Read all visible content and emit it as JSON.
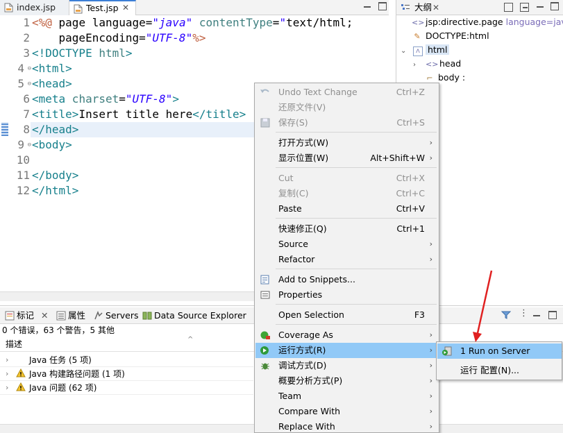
{
  "editor": {
    "tabs": [
      {
        "label": "index.jsp"
      },
      {
        "label": "Test.jsp",
        "active": true
      }
    ],
    "lines": [
      {
        "num": "1",
        "text": "<%@ page language=\"java\" contentType=\"text/html;"
      },
      {
        "num": "2",
        "text": "    pageEncoding=\"UTF-8\"%>"
      },
      {
        "num": "3",
        "text": "<!DOCTYPE html>"
      },
      {
        "num": "4",
        "text": "<html>"
      },
      {
        "num": "5",
        "text": "<head>"
      },
      {
        "num": "6",
        "text": "<meta charset=\"UTF-8\">"
      },
      {
        "num": "7",
        "text": "<title>Insert title here</title>"
      },
      {
        "num": "8",
        "text": "</head>"
      },
      {
        "num": "9",
        "text": "<body>"
      },
      {
        "num": "10",
        "text": ""
      },
      {
        "num": "11",
        "text": "</body>"
      },
      {
        "num": "12",
        "text": "</html>"
      }
    ],
    "fold_marker": "⊖"
  },
  "outline": {
    "tab_label": "大纲",
    "items": [
      {
        "label": "jsp:directive.page",
        "attr": "language=java"
      },
      {
        "label": "DOCTYPE:html"
      },
      {
        "label": "html"
      },
      {
        "label": "head"
      },
      {
        "label": "body :"
      }
    ]
  },
  "bottom": {
    "tabs": [
      {
        "label": "标记",
        "close": "✕"
      },
      {
        "label": "属性"
      },
      {
        "label": "Servers"
      },
      {
        "label": "Data Source Explorer"
      }
    ],
    "summary": "0 个错误，63 个警告，5 其他",
    "header": "描述",
    "rows": [
      {
        "label": "Java 任务  (5 项)"
      },
      {
        "label": "Java 构建路径问题  (1 项)"
      },
      {
        "label": "Java 问题  (62 项)"
      }
    ]
  },
  "context_menu": {
    "items": [
      {
        "label": "Undo Text Change",
        "shortcut": "Ctrl+Z",
        "disabled": true
      },
      {
        "label": "还原文件(V)",
        "disabled": true
      },
      {
        "label": "保存(S)",
        "shortcut": "Ctrl+S",
        "disabled": true
      },
      {
        "label": "打开方式(W)",
        "arrow": "›"
      },
      {
        "label": "显示位置(W)",
        "shortcut": "Alt+Shift+W",
        "arrow": "›"
      },
      {
        "label": "Cut",
        "shortcut": "Ctrl+X",
        "disabled": true
      },
      {
        "label": "复制(C)",
        "shortcut": "Ctrl+C",
        "disabled": true
      },
      {
        "label": "Paste",
        "shortcut": "Ctrl+V"
      },
      {
        "label": "快速修正(Q)",
        "shortcut": "Ctrl+1"
      },
      {
        "label": "Source",
        "arrow": "›"
      },
      {
        "label": "Refactor",
        "arrow": "›"
      },
      {
        "label": "Add to Snippets..."
      },
      {
        "label": "Properties"
      },
      {
        "label": "Open Selection",
        "shortcut": "F3"
      },
      {
        "label": "Coverage As",
        "arrow": "›"
      },
      {
        "label": "运行方式(R)",
        "arrow": "›",
        "selected": true
      },
      {
        "label": "调试方式(D)",
        "arrow": "›"
      },
      {
        "label": "概要分析方式(P)",
        "arrow": "›"
      },
      {
        "label": "Team",
        "arrow": "›"
      },
      {
        "label": "Compare With",
        "arrow": "›"
      },
      {
        "label": "Replace With",
        "arrow": "›"
      }
    ]
  },
  "submenu": {
    "items": [
      {
        "label": "1 Run on Server",
        "selected": true
      },
      {
        "label": "运行 配置(N)..."
      }
    ]
  },
  "colors": {
    "selection": "#91c9f7",
    "annotation_arrow": "#e02020",
    "tab_accent": "#3c7fd6"
  }
}
